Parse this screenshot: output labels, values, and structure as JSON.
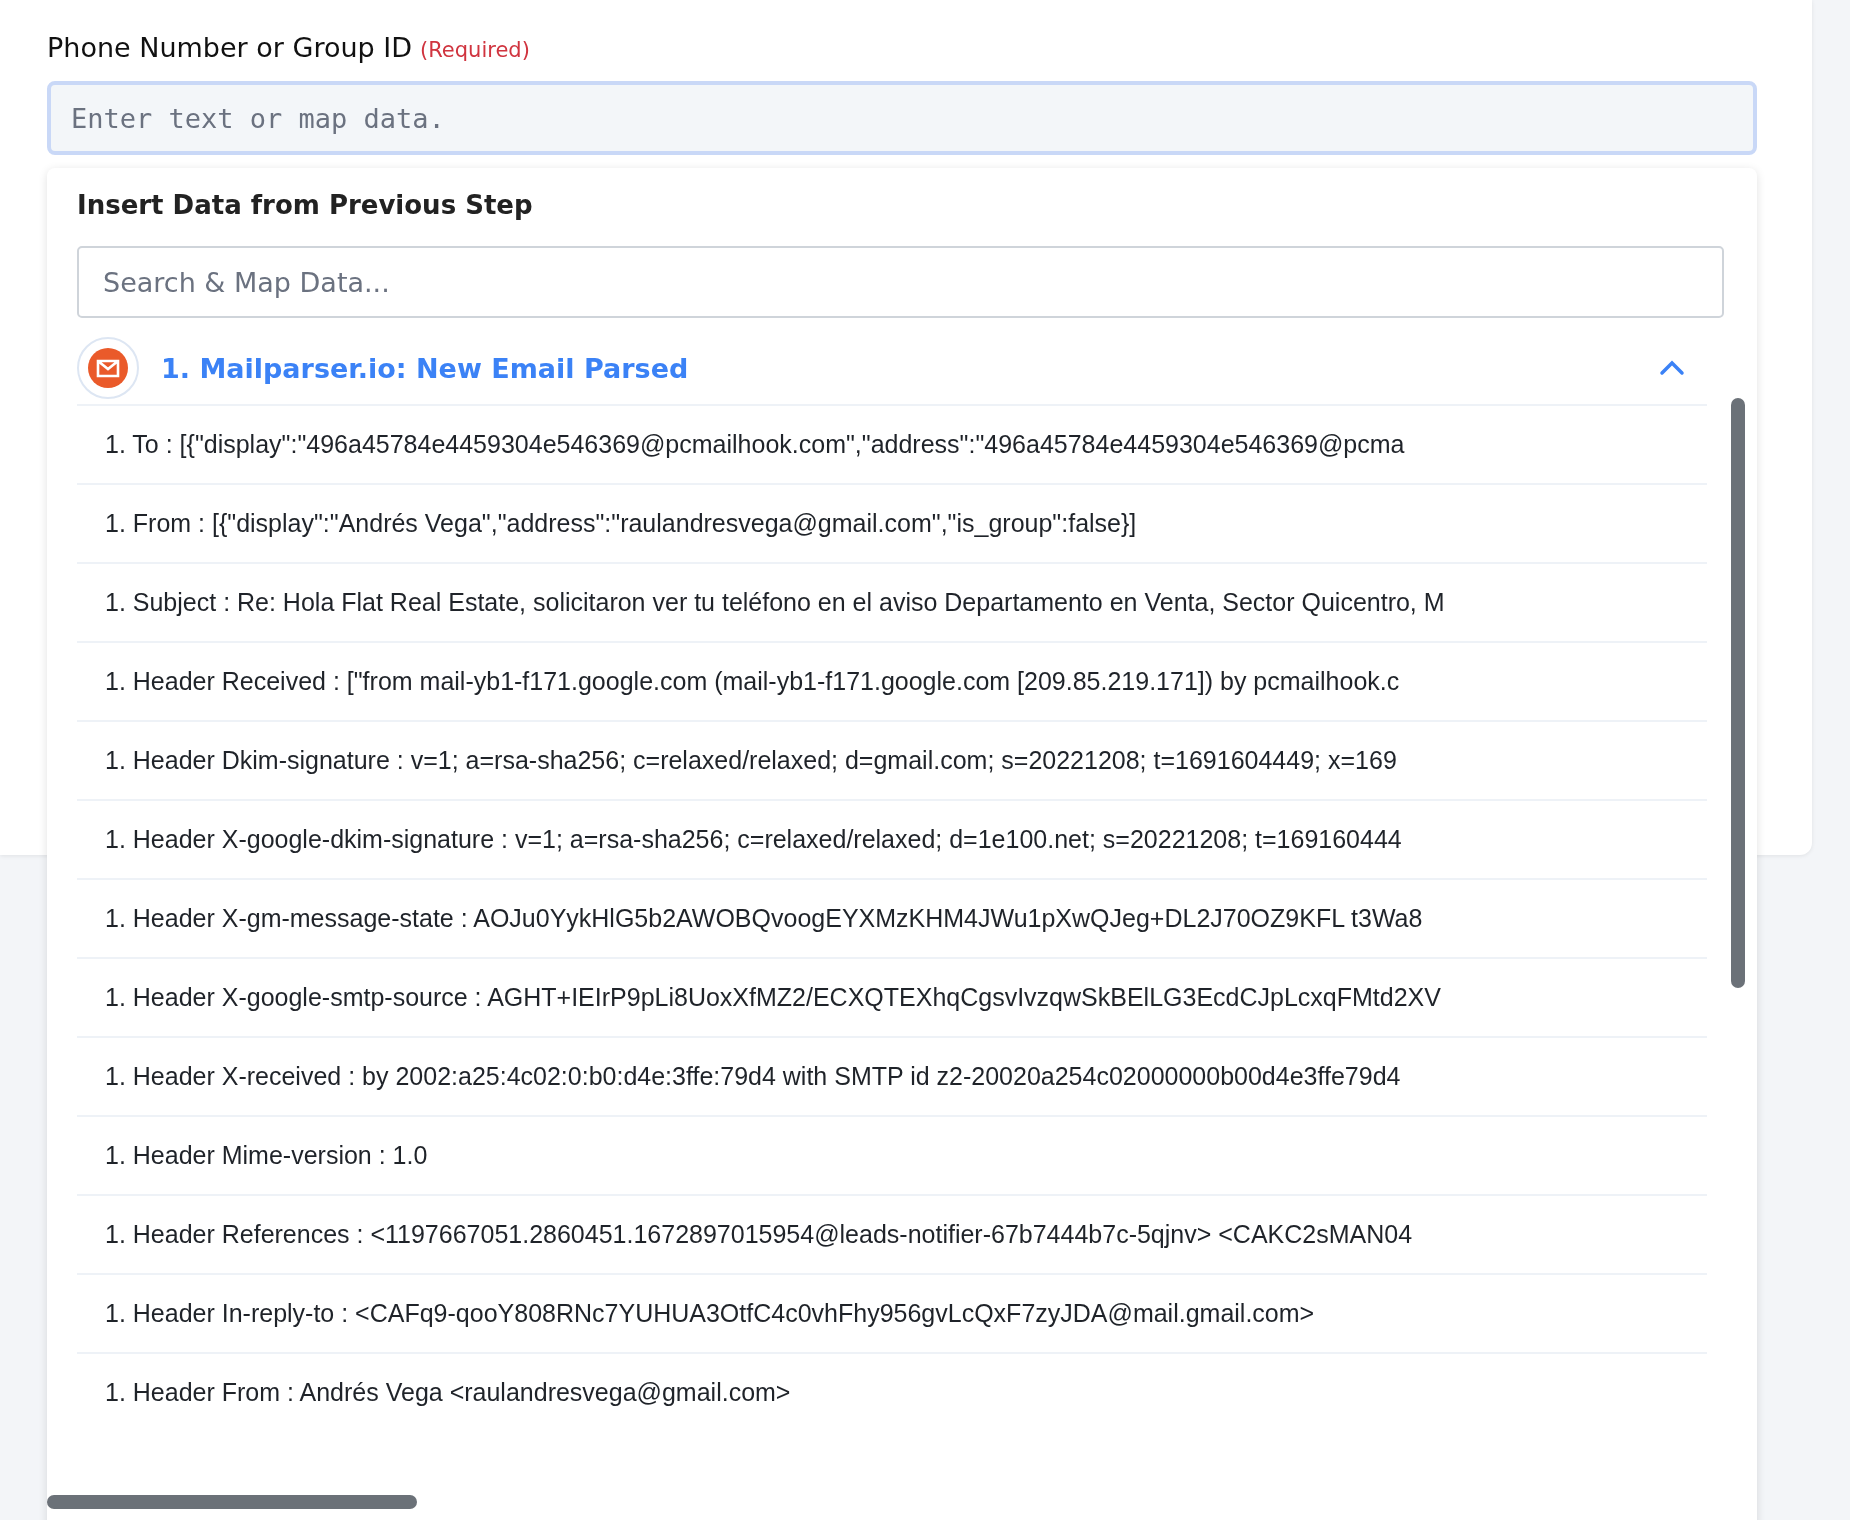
{
  "field": {
    "label": "Phone Number or Group ID",
    "required_note": "(Required)",
    "placeholder": "Enter text or map data."
  },
  "dropdown": {
    "title": "Insert Data from Previous Step",
    "search": {
      "placeholder": "Search & Map Data..."
    },
    "step": {
      "title": "1. Mailparser.io: New Email Parsed",
      "expanded": true,
      "items": [
        "1. To : [{\"display\":\"496a45784e4459304e546369@pcmailhook.com\",\"address\":\"496a45784e4459304e546369@pcma",
        "1. From : [{\"display\":\"Andrés Vega\",\"address\":\"raulandresvega@gmail.com\",\"is_group\":false}]",
        "1. Subject : Re: Hola Flat Real Estate, solicitaron ver tu teléfono en el aviso Departamento en Venta, Sector Quicentro, M",
        "1. Header Received : [\"from mail-yb1-f171.google.com (mail-yb1-f171.google.com [209.85.219.171]) by pcmailhook.c",
        "1. Header Dkim-signature : v=1; a=rsa-sha256; c=relaxed/relaxed; d=gmail.com; s=20221208; t=1691604449; x=169",
        "1. Header X-google-dkim-signature : v=1; a=rsa-sha256; c=relaxed/relaxed; d=1e100.net; s=20221208; t=169160444",
        "1. Header X-gm-message-state : AOJu0YykHlG5b2AWOBQvoogEYXMzKHM4JWu1pXwQJeg+DL2J70OZ9KFL t3Wa8",
        "1. Header X-google-smtp-source : AGHT+IEIrP9pLi8UoxXfMZ2/ECXQTEXhqCgsvIvzqwSkBElLG3EcdCJpLcxqFMtd2XV",
        "1. Header X-received : by 2002:a25:4c02:0:b0:d4e:3ffe:79d4 with SMTP id z2-20020a254c02000000b00d4e3ffe79d4",
        "1. Header Mime-version : 1.0",
        "1. Header References : <1197667051.2860451.1672897015954@leads-notifier-67b7444b7c-5qjnv> <CAKC2sMAN04",
        "1. Header In-reply-to : <CAFq9-qooY808RNc7YUHUA3OtfC4c0vhFhy956gvLcQxF7zyJDA@mail.gmail.com>",
        "1. Header From : Andrés Vega <raulandresvega@gmail.com>"
      ]
    }
  }
}
